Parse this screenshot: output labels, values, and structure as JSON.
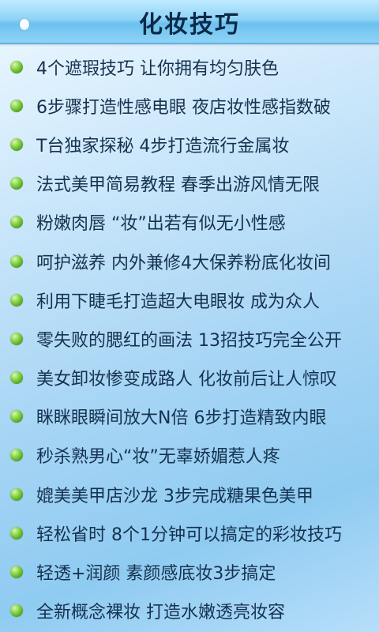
{
  "header": {
    "title": "化妆技巧"
  },
  "articles": [
    "4个遮瑕技巧 让你拥有均匀肤色",
    "6步骤打造性感电眼 夜店妆性感指数破",
    "T台独家探秘 4步打造流行金属妆",
    "法式美甲简易教程 春季出游风情无限",
    "粉嫩肉唇 “妆”出若有似无小性感",
    "呵护滋养 内外兼修4大保养粉底化妆间",
    "利用下睫毛打造超大电眼妆 成为众人",
    "零失败的腮红的画法 13招技巧完全公开",
    "美女卸妆惨变成路人 化妆前后让人惊叹",
    "眯眯眼瞬间放大N倍 6步打造精致内眼",
    "秒杀熟男心“妆”无辜娇媚惹人疼",
    "媲美美甲店沙龙 3步完成糖果色美甲",
    "轻松省时 8个1分钟可以搞定的彩妆技巧",
    "轻透+润颜 素颜感底妆3步搞定",
    "全新概念裸妆 打造水嫩透亮妆容"
  ],
  "icons": {
    "bullet": "green-sphere-bullet-icon",
    "header_dot": "white-dot-icon"
  }
}
